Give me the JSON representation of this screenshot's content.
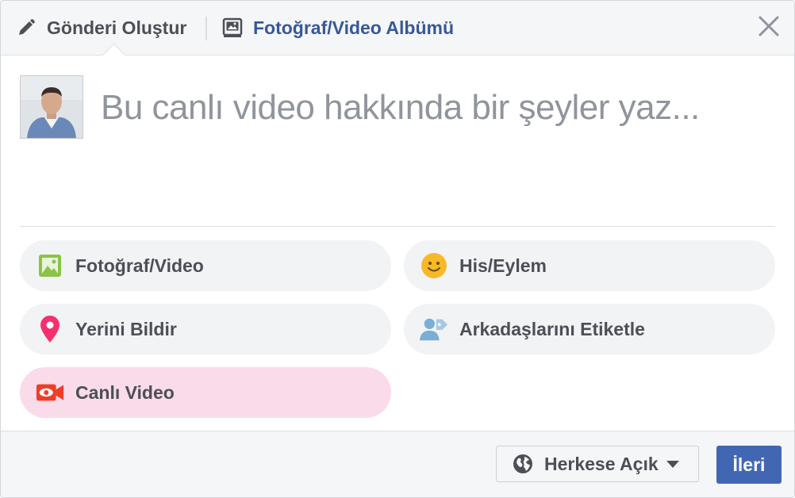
{
  "header": {
    "create_post_label": "Gönderi Oluştur",
    "album_label": "Fotoğraf/Video Albümü",
    "create_icon": "pencil-icon",
    "album_icon": "photo-album-icon",
    "close_icon": "close-icon"
  },
  "composer": {
    "placeholder": "Bu canlı video hakkında bir şeyler yaz...",
    "avatar": "user-avatar"
  },
  "options": [
    {
      "label": "Fotoğraf/Video",
      "icon": "photo-icon",
      "color": "#8bc34a",
      "active": false
    },
    {
      "label": "His/Eylem",
      "icon": "smiley-icon",
      "color": "#f7b928",
      "active": false
    },
    {
      "label": "Yerini Bildir",
      "icon": "location-pin-icon",
      "color": "#f5306c",
      "active": false
    },
    {
      "label": "Arkadaşlarını Etiketle",
      "icon": "tag-friends-icon",
      "color": "#7aaed6",
      "active": false
    },
    {
      "label": "Canlı Video",
      "icon": "live-video-icon",
      "color": "#f03d25",
      "active": true
    }
  ],
  "footer": {
    "audience_label": "Herkese Açık",
    "audience_icon": "globe-icon",
    "next_label": "İleri"
  },
  "colors": {
    "brand_blue": "#4267b2",
    "link_blue": "#365899",
    "active_pill": "#f9dbea",
    "pill_bg": "#f2f3f5"
  }
}
